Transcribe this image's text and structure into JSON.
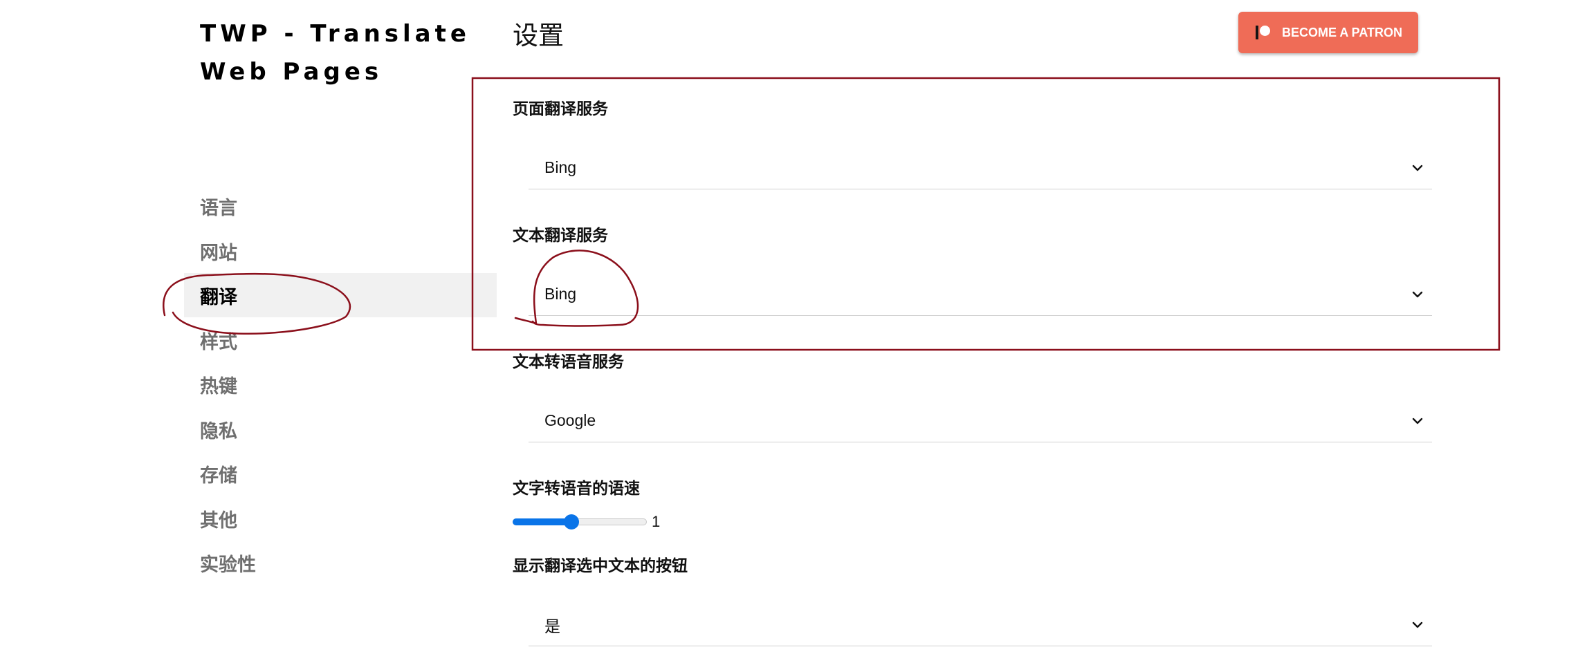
{
  "sidebar": {
    "title_line1": "TWP - Translate",
    "title_line2": "Web Pages",
    "items": [
      {
        "label": "语言"
      },
      {
        "label": "网站"
      },
      {
        "label": "翻译",
        "active": true
      },
      {
        "label": "样式"
      },
      {
        "label": "热键"
      },
      {
        "label": "隐私"
      },
      {
        "label": "存储"
      },
      {
        "label": "其他"
      },
      {
        "label": "实验性"
      }
    ]
  },
  "main": {
    "title": "设置",
    "patron_button": "BECOME A PATRON",
    "page_translation_service": {
      "label": "页面翻译服务",
      "value": "Bing"
    },
    "text_translation_service": {
      "label": "文本翻译服务",
      "value": "Bing"
    },
    "tts_service": {
      "label": "文本转语音服务",
      "value": "Google"
    },
    "tts_speed": {
      "label": "文字转语音的语速",
      "value": "1",
      "fraction": 0.44
    },
    "show_translate_selected_button": {
      "label": "显示翻译选中文本的按钮",
      "value": "是"
    }
  },
  "colors": {
    "accent": "#0a74e8",
    "patron": "#ef6c57",
    "annotation": "#8b0f1b",
    "active_nav_bg": "#f1f1f1"
  },
  "icons": {
    "patron": "patreon-icon",
    "dropdown": "chevron-down-icon"
  }
}
